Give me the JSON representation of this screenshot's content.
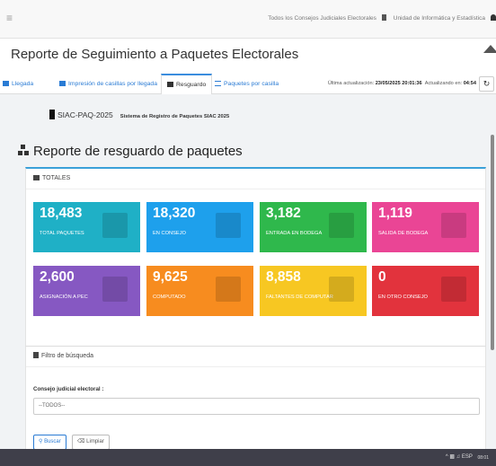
{
  "topbar": {
    "menu_glyph": "≡",
    "council_selector": "Todos los Consejos Judiciales Electorales",
    "unit_label": "Unidad de Informática y Estadística"
  },
  "page": {
    "title": "Reporte de Seguimiento a Paquetes Electorales"
  },
  "tabs": [
    {
      "label": "Llegada",
      "icon": "calendar-icon",
      "active": false
    },
    {
      "label": "Impresión de casillas por llegada",
      "icon": "calendar-icon",
      "active": false
    },
    {
      "label": "Resguardo",
      "icon": "boxes-icon",
      "active": true
    },
    {
      "label": "Paquetes por casilla",
      "icon": "list-icon",
      "active": false
    }
  ],
  "update": {
    "prefix": "Última actualización:",
    "datetime": "23/05/2025 20:01:36",
    "countdown_prefix": "Actualizando en:",
    "countdown": "04:54"
  },
  "system": {
    "code": "SIAC-PAQ-2025",
    "name": "Sistema de Registro de Paquetes SIAC 2025"
  },
  "report": {
    "title": "Reporte de resguardo de paquetes",
    "totals_heading": "TOTALES",
    "tiles": [
      {
        "value": "18,483",
        "label": "TOTAL PAQUETES",
        "color": "#1fb0c6"
      },
      {
        "value": "18,320",
        "label": "EN CONSEJO",
        "color": "#1ea0ec"
      },
      {
        "value": "3,182",
        "label": "ENTRADA EN BODEGA",
        "color": "#2fb84c"
      },
      {
        "value": "1,119",
        "label": "SALIDA DE BODEGA",
        "color": "#ea4595"
      },
      {
        "value": "2,600",
        "label": "ASIGNACIÓN A PEC",
        "color": "#8658c2"
      },
      {
        "value": "9,625",
        "label": "COMPUTADO",
        "color": "#f78c1f"
      },
      {
        "value": "8,858",
        "label": "FALTANTES DE COMPUTAR",
        "color": "#f7c722"
      },
      {
        "value": "0",
        "label": "EN OTRO CONSEJO",
        "color": "#e2333d"
      }
    ]
  },
  "filter": {
    "heading": "Filtro de búsqueda",
    "field_label": "Consejo judicial electoral :",
    "selected_value": "--TODOS--",
    "search_button": "Buscar",
    "clear_button": "Limpiar"
  },
  "taskbar": {
    "language": "ESP",
    "time": "08:01"
  }
}
